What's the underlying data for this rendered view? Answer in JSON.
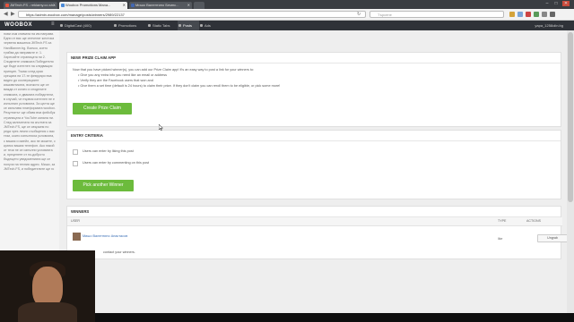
{
  "browser": {
    "tabs": [
      {
        "label": "JMTech.FS - reklamy.co.sh...",
        "active": false
      },
      {
        "label": "Woobox Promotions Mana...",
        "active": true
      },
      {
        "label": "Мишо Валентино Бемпс...",
        "active": false
      },
      {
        "label": "",
        "active": false
      }
    ],
    "url": "https://admin.woobox.com/manage/posts/winners/2989/22137",
    "search_placeholder": "Търсене"
  },
  "app": {
    "logo": "WOOBOX",
    "nav": [
      {
        "label": "DigitalCast (400)",
        "active": false
      },
      {
        "label": "Promotions",
        "active": false
      },
      {
        "label": "Static Tabs",
        "active": false
      },
      {
        "label": "Posts",
        "active": true
      },
      {
        "label": "Ads",
        "active": false
      }
    ],
    "user": "yapa_1258olin.bg"
  },
  "sidebar": {
    "text": "нови към снимата на им направи. Едни от вас ще спечелят жестока червена машинка JMTech.FS за HardBanner.bg. Всичко, което трябва да направите е: 1. Харесайте страницата ни 2. Споделете снимката Победителя ще бъде изтеглен на следващия принцип. Тъкмо след края срещата ни 17-те февруари във видео до кооперациите кишовитиката, всичкото ще се вижда от когато и споделите снимката, и двамата победители, в случай, че първия изтеглен не е изпълнил условията. За целта ще се използва платформата woobox. Резултатът ще обявя във фейсбук страницата и YouTube канала ни. След заличената на жълтата за JMTech.FS, ще се свържем по реда чрез лични съобщения с вас тези, които изпълниха условията, с вашия и имейл, ако не можете, с кратко вашия телефон. Ако някой от тези не се изпълни условията и, преценете от по-доброто бъдещето уведоменията ще се получи на техния адрес. Мишо, за JMTech.FS, и победителите ще го"
  },
  "prize_claim": {
    "title": "NEW! PRIZE CLAIM APP",
    "intro": "Now that you have picked winner(s), you can add our Prize Claim app! It's an easy way to post a link for your winners to:",
    "bullets": [
      "Give you any extra info you need like an email or address",
      "Verify they are the Facebook users that won and",
      "Give them a set time (default is 24 hours) to claim their prize. If they don't claim you can reroll them to be eligible, or pick some more!"
    ],
    "button": "Create Prize Claim"
  },
  "entry_criteria": {
    "title": "ENTRY CRITERIA",
    "options": [
      {
        "label": "Users can enter by liking this post",
        "checked": false
      },
      {
        "label": "Users can enter by commenting on this post",
        "checked": false
      }
    ],
    "button": "Pick another Winner"
  },
  "winners": {
    "title": "WINNERS",
    "columns": [
      "USER",
      "TYPE",
      "ACTIONS"
    ],
    "rows": [
      {
        "user": "Мишо Валентино Анастасов",
        "type": "like",
        "action": "Ungrab"
      }
    ],
    "footer": "contact your winners."
  },
  "colors": {
    "accent_green": "#6cbb3c",
    "header_dark": "#2f3238",
    "link_blue": "#3b6fb6"
  }
}
